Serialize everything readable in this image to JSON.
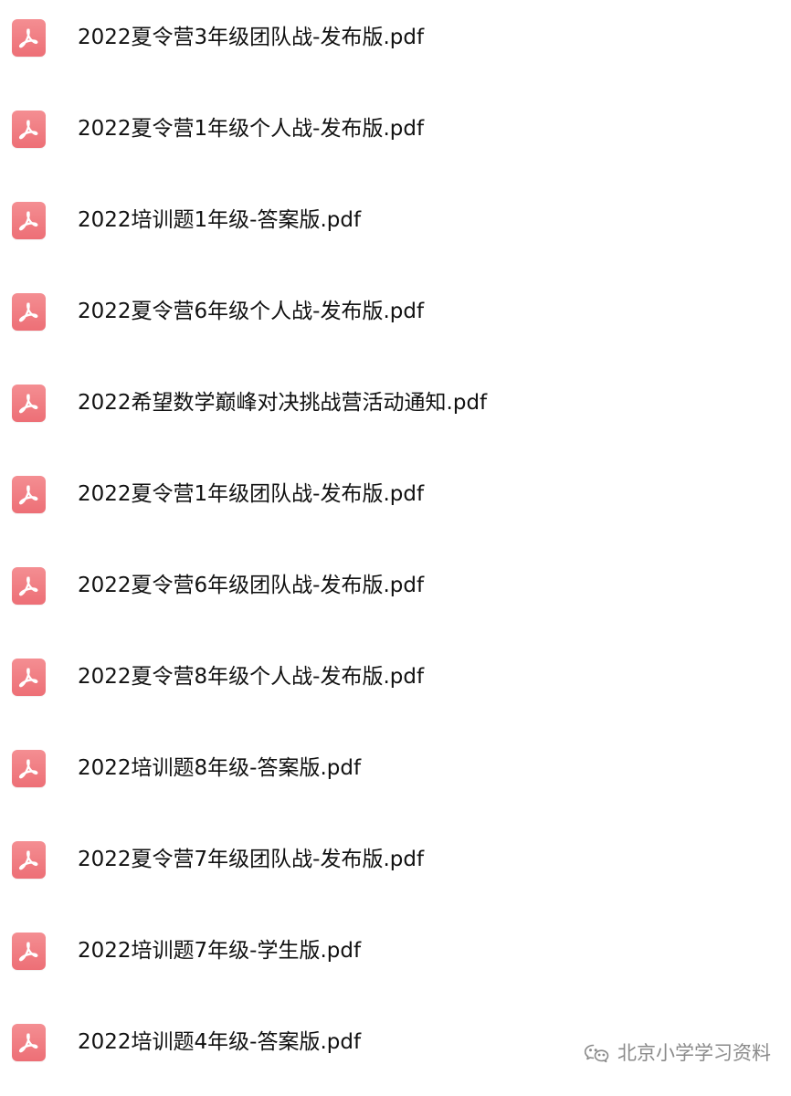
{
  "colors": {
    "pdf_icon_top": "#f48e92",
    "pdf_icon_bottom": "#ed6f76",
    "text": "#111111",
    "watermark": "#8a8a8a",
    "background": "#ffffff"
  },
  "files": [
    {
      "name": "2022夏令营3年级团队战-发布版.pdf",
      "icon": "pdf-icon"
    },
    {
      "name": "2022夏令营1年级个人战-发布版.pdf",
      "icon": "pdf-icon"
    },
    {
      "name": "2022培训题1年级-答案版.pdf",
      "icon": "pdf-icon"
    },
    {
      "name": "2022夏令营6年级个人战-发布版.pdf",
      "icon": "pdf-icon"
    },
    {
      "name": "2022希望数学巅峰对决挑战营活动通知.pdf",
      "icon": "pdf-icon"
    },
    {
      "name": "2022夏令营1年级团队战-发布版.pdf",
      "icon": "pdf-icon"
    },
    {
      "name": "2022夏令营6年级团队战-发布版.pdf",
      "icon": "pdf-icon"
    },
    {
      "name": "2022夏令营8年级个人战-发布版.pdf",
      "icon": "pdf-icon"
    },
    {
      "name": "2022培训题8年级-答案版.pdf",
      "icon": "pdf-icon"
    },
    {
      "name": "2022夏令营7年级团队战-发布版.pdf",
      "icon": "pdf-icon"
    },
    {
      "name": "2022培训题7年级-学生版.pdf",
      "icon": "pdf-icon"
    },
    {
      "name": "2022培训题4年级-答案版.pdf",
      "icon": "pdf-icon"
    }
  ],
  "watermark": {
    "icon": "wechat-icon",
    "text": "北京小学学习资料"
  }
}
